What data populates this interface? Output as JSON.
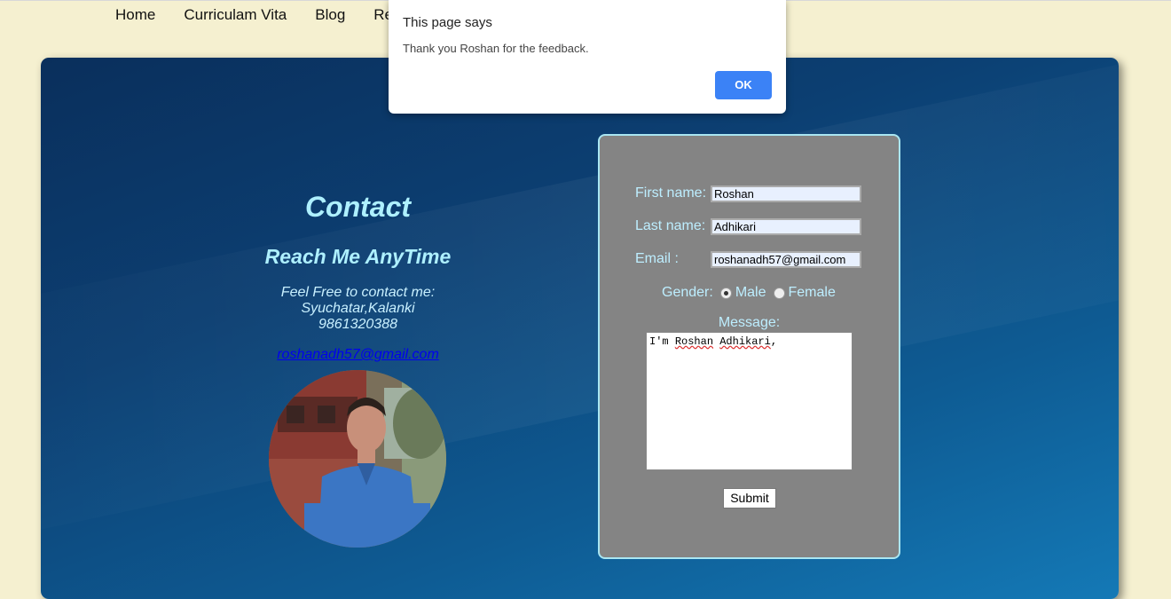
{
  "nav": {
    "items": [
      "Home",
      "Curriculam Vita",
      "Blog",
      "Re"
    ]
  },
  "contact": {
    "title": "Contact",
    "subtitle": "Reach Me AnyTime",
    "line1": "Feel Free to contact me:",
    "line2": "Syuchatar,Kalanki",
    "phone": "9861320388",
    "email": "roshanadh57@gmail.com"
  },
  "form": {
    "first_label": "First name:",
    "first_value": "Roshan",
    "last_label": "Last name:",
    "last_value": "Adhikari",
    "email_label": "Email :",
    "email_value": "roshanadh57@gmail.com",
    "gender_label": "Gender:",
    "male": "Male",
    "female": "Female",
    "selected_gender": "Male",
    "message_label": "Message:",
    "message_value_pre": "I'm ",
    "message_word1": "Roshan",
    "message_mid": " ",
    "message_word2": "Adhikari",
    "message_post": ",",
    "submit": "Submit"
  },
  "dialog": {
    "title": "This page says",
    "message": "Thank you Roshan for the feedback.",
    "ok": "OK"
  },
  "colors": {
    "accent": "#3b82f6",
    "panel_border": "#a9e6f2",
    "text_cyan": "#bdeeff"
  }
}
